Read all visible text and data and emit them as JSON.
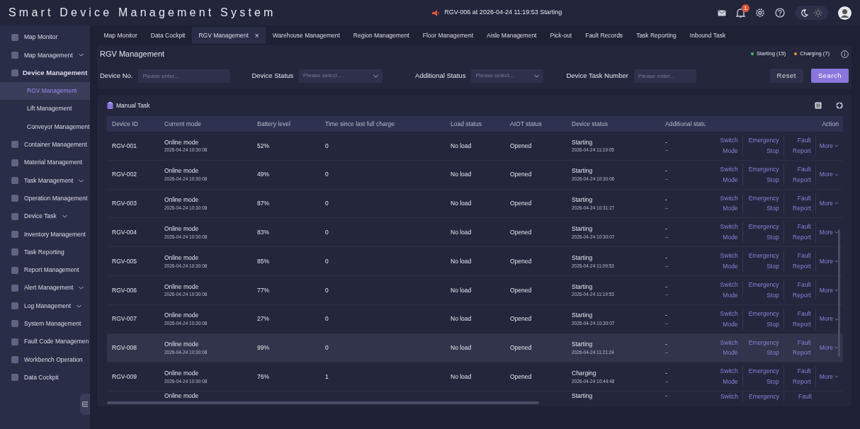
{
  "app_title": "Smart Device Management System",
  "alert": {
    "text": "RGV-006 at 2026-04-24 11:19:53 Starting"
  },
  "notifications": {
    "badge": "1"
  },
  "theme": {
    "dark": true
  },
  "sidebar": {
    "items": [
      {
        "label": "Map Monitor",
        "chevron": false
      },
      {
        "label": "Map Management",
        "chevron": true
      },
      {
        "label": "Device Management",
        "chevron": false,
        "expanded": true,
        "children": [
          {
            "label": "RGV Management",
            "selected": true
          },
          {
            "label": "Lift Management",
            "selected": false
          },
          {
            "label": "Conveyor Management",
            "selected": false
          }
        ]
      },
      {
        "label": "Container Management",
        "chevron": false
      },
      {
        "label": "Material Management",
        "chevron": false
      },
      {
        "label": "Task Management",
        "chevron": true
      },
      {
        "label": "Operation Management",
        "chevron": false
      },
      {
        "label": "Device Task",
        "chevron": true
      },
      {
        "label": "Inventory Management",
        "chevron": false
      },
      {
        "label": "Task Reporting",
        "chevron": false
      },
      {
        "label": "Report Management",
        "chevron": false
      },
      {
        "label": "Alert Management",
        "chevron": true
      },
      {
        "label": "Log Management",
        "chevron": true
      },
      {
        "label": "System Management",
        "chevron": false
      },
      {
        "label": "Fault Code Managemen",
        "chevron": false
      },
      {
        "label": "Workbench Operation",
        "chevron": false
      },
      {
        "label": "Data Cockpit",
        "chevron": false
      }
    ]
  },
  "tabs": [
    {
      "label": "Map Monitor",
      "selected": false
    },
    {
      "label": "Data Cockpit",
      "selected": false
    },
    {
      "label": "RGV Management",
      "selected": true,
      "close": "×"
    },
    {
      "label": "Warehouse Management",
      "selected": false
    },
    {
      "label": "Region Management",
      "selected": false
    },
    {
      "label": "Floor Management",
      "selected": false
    },
    {
      "label": "Aisle Management",
      "selected": false
    },
    {
      "label": "Pick-out",
      "selected": false
    },
    {
      "label": "Fault Records",
      "selected": false
    },
    {
      "label": "Task Reporting",
      "selected": false
    },
    {
      "label": "Inbound Task",
      "selected": false
    }
  ],
  "page_title": "RGV Management",
  "legend": [
    {
      "label": "Starting (15)",
      "color": "#3fbf6a"
    },
    {
      "label": "Charging (7)",
      "color": "#e8953a"
    }
  ],
  "filters": [
    {
      "kind": "input",
      "label": "Device No.",
      "placeholder": "Please enter..."
    },
    {
      "kind": "select",
      "label": "Device Status",
      "placeholder": "Please select..."
    },
    {
      "kind": "select",
      "label": "Additional Status",
      "placeholder": "Please select..."
    },
    {
      "kind": "input",
      "label": "Device Task Number",
      "placeholder": "Please enter..."
    }
  ],
  "buttons": [
    {
      "label": "Reset",
      "kind": "secondary"
    },
    {
      "label": "Search",
      "kind": "primary"
    }
  ],
  "manual_task": "Manual Task",
  "table": {
    "columns": [
      "Device ID",
      "Current mode",
      "Battery level",
      "Time since last full charge",
      "Load status",
      "AIOT status",
      "Device status",
      "Additional statu",
      "Action"
    ],
    "rows": [
      {
        "id": "RGV-001",
        "mode": "Online mode",
        "mode_time": "2026-04-24 10:30:08",
        "battery": "52%",
        "since": "0",
        "load": "No load",
        "aiot": "Opened",
        "status": "Starting",
        "status_time": "2026-04-24 11:19:05",
        "additional": "-",
        "additional_2": "--",
        "actions": [
          "Switch Mode",
          "Emergency Stop",
          "Fault Report"
        ],
        "more": "More",
        "selected": false
      },
      {
        "id": "RGV-002",
        "mode": "Online mode",
        "mode_time": "2026-04-24 10:30:08",
        "battery": "49%",
        "since": "0",
        "load": "No load",
        "aiot": "Opened",
        "status": "Starting",
        "status_time": "2026-04-24 10:30:06",
        "additional": "-",
        "additional_2": "--",
        "actions": [
          "Switch Mode",
          "Emergency Stop",
          "Fault Report"
        ],
        "more": "More",
        "selected": false
      },
      {
        "id": "RGV-003",
        "mode": "Online mode",
        "mode_time": "2026-04-24 10:30:08",
        "battery": "87%",
        "since": "0",
        "load": "No load",
        "aiot": "Opened",
        "status": "Starting",
        "status_time": "2026-04-24 10:31:27",
        "additional": "-",
        "additional_2": "--",
        "actions": [
          "Switch Mode",
          "Emergency Stop",
          "Fault Report"
        ],
        "more": "More",
        "selected": false
      },
      {
        "id": "RGV-004",
        "mode": "Online mode",
        "mode_time": "2026-04-24 10:30:08",
        "battery": "83%",
        "since": "0",
        "load": "No load",
        "aiot": "Opened",
        "status": "Starting",
        "status_time": "2026-04-24 10:30:07",
        "additional": "-",
        "additional_2": "--",
        "actions": [
          "Switch Mode",
          "Emergency Stop",
          "Fault Report"
        ],
        "more": "More",
        "selected": false
      },
      {
        "id": "RGV-005",
        "mode": "Online mode",
        "mode_time": "2026-04-24 10:30:08",
        "battery": "85%",
        "since": "0",
        "load": "No load",
        "aiot": "Opened",
        "status": "Starting",
        "status_time": "2026-04-24 11:09:53",
        "additional": "-",
        "additional_2": "--",
        "actions": [
          "Switch Mode",
          "Emergency Stop",
          "Fault Report"
        ],
        "more": "More",
        "selected": false
      },
      {
        "id": "RGV-006",
        "mode": "Online mode",
        "mode_time": "2026-04-24 10:30:08",
        "battery": "77%",
        "since": "0",
        "load": "No load",
        "aiot": "Opened",
        "status": "Starting",
        "status_time": "2026-04-24 11:19:53",
        "additional": "-",
        "additional_2": "--",
        "actions": [
          "Switch Mode",
          "Emergency Stop",
          "Fault Report"
        ],
        "more": "More",
        "selected": false
      },
      {
        "id": "RGV-007",
        "mode": "Online mode",
        "mode_time": "2026-04-24 10:30:08",
        "battery": "27%",
        "since": "0",
        "load": "No load",
        "aiot": "Opened",
        "status": "Starting",
        "status_time": "2026-04-24 10:30:07",
        "additional": "-",
        "additional_2": "--",
        "actions": [
          "Switch Mode",
          "Emergency Stop",
          "Fault Report"
        ],
        "more": "More",
        "selected": false
      },
      {
        "id": "RGV-008",
        "mode": "Online mode",
        "mode_time": "2026-04-24 10:30:08",
        "battery": "99%",
        "since": "0",
        "load": "No load",
        "aiot": "Opened",
        "status": "Starting",
        "status_time": "2026-04-24 11:21:24",
        "additional": "-",
        "additional_2": "--",
        "actions": [
          "Switch Mode",
          "Emergency Stop",
          "Fault Report"
        ],
        "more": "More",
        "selected": true
      },
      {
        "id": "RGV-009",
        "mode": "Online mode",
        "mode_time": "2026-04-24 10:30:08",
        "battery": "76%",
        "since": "1",
        "load": "No load",
        "aiot": "Opened",
        "status": "Charging",
        "status_time": "2026-04-24 10:44:48",
        "additional": "-",
        "additional_2": "--",
        "actions": [
          "Switch Mode",
          "Emergency Stop",
          "Fault Report"
        ],
        "more": "More",
        "selected": false
      },
      {
        "mode": "Online mode",
        "status": "Starting",
        "additional": "-",
        "actions": [
          "Switch",
          "Emergency",
          "Fault"
        ],
        "selected": false
      }
    ]
  }
}
